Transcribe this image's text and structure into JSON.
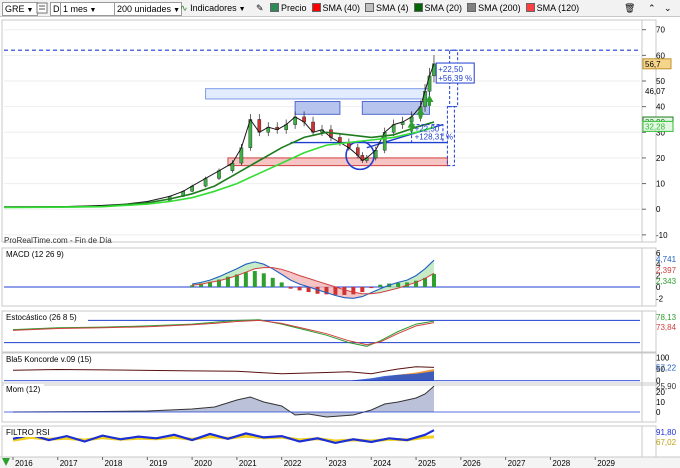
{
  "toolbar": {
    "ticker": "GRE",
    "period_code": "D",
    "timeframe": "1 mes",
    "units": "200 unidades",
    "indicators_label": "Indicadores",
    "legend": [
      {
        "label": "Precio",
        "color": "#2e8b57"
      },
      {
        "label": "SMA (40)",
        "color": "#ff0000"
      },
      {
        "label": "SMA (4)",
        "color": "#c0c0c0"
      },
      {
        "label": "SMA (20)",
        "color": "#006400"
      },
      {
        "label": "SMA (200)",
        "color": "#808080"
      },
      {
        "label": "SMA (120)",
        "color": "#ff4040"
      }
    ]
  },
  "chart_data": [
    {
      "type": "line",
      "panel": "price",
      "source_text": "ProRealTime.com - Fin de Día",
      "x_ticks": [
        "2016",
        "2017",
        "2018",
        "2019",
        "2020",
        "2021",
        "2022",
        "2023",
        "2024",
        "2025",
        "2026",
        "2027",
        "2028",
        "2029"
      ],
      "y_ticks": [
        "70",
        "60",
        "50",
        "40",
        "30",
        "20",
        "10",
        "0",
        "-10"
      ],
      "ylim": [
        -12,
        73
      ],
      "xlim": [
        2015.8,
        2030.0
      ],
      "series": [
        {
          "name": "Precio",
          "color": "#1a1a1a",
          "x": [
            2015.8,
            2016.5,
            2017.0,
            2017.5,
            2018.0,
            2018.5,
            2019.0,
            2019.5,
            2019.8,
            2020.0,
            2020.3,
            2020.6,
            2020.9,
            2021.1,
            2021.3,
            2021.5,
            2021.7,
            2021.9,
            2022.1,
            2022.3,
            2022.5,
            2022.7,
            2022.9,
            2023.1,
            2023.3,
            2023.5,
            2023.7,
            2023.8,
            2023.9,
            2024.1,
            2024.3,
            2024.5,
            2024.7,
            2024.9,
            2025.1,
            2025.2,
            2025.3,
            2025.4
          ],
          "y": [
            1,
            1,
            1,
            1.2,
            1.5,
            2,
            3,
            5,
            7,
            9,
            12,
            15,
            18,
            24,
            35,
            30,
            32,
            31,
            33,
            36,
            34,
            30,
            31,
            28,
            26,
            24,
            21,
            19,
            20,
            23,
            30,
            33,
            34,
            36,
            40,
            46,
            52,
            56.7
          ]
        },
        {
          "name": "SMA (20)",
          "color": "#1e7b1e",
          "x": [
            2015.8,
            2017.0,
            2018.0,
            2019.0,
            2019.5,
            2020.0,
            2020.5,
            2021.0,
            2021.5,
            2022.0,
            2022.5,
            2023.0,
            2023.5,
            2024.0,
            2024.5,
            2025.0,
            2025.4
          ],
          "y": [
            0.8,
            0.9,
            1.1,
            2.5,
            4,
            6,
            9,
            14,
            19,
            24,
            28,
            30,
            29,
            28,
            29,
            32,
            34
          ]
        },
        {
          "name": "SMA (40)",
          "color": "#33dd33",
          "x": [
            2015.8,
            2017.0,
            2018.0,
            2019.0,
            2019.5,
            2020.0,
            2020.5,
            2021.0,
            2021.5,
            2022.0,
            2022.5,
            2023.0,
            2023.5,
            2024.0,
            2024.5,
            2025.0,
            2025.4
          ],
          "y": [
            0.7,
            0.8,
            1,
            2,
            3,
            4.5,
            7,
            10,
            14,
            18,
            22,
            25,
            26,
            27,
            28,
            30,
            32
          ]
        }
      ],
      "annotations": {
        "price_label": "56,7",
        "level_label": "46,07",
        "labels_right": [
          "33,99",
          "32,28"
        ],
        "projection_up": {
          "line1": "+22,50",
          "line2": "+56,39 %"
        },
        "projection_mid": {
          "line1": "+22,50",
          "line2": "+128,31 %"
        },
        "resistance_level": 62
      }
    },
    {
      "type": "bar",
      "panel": "macd",
      "title": "MACD (12 26 9)",
      "y_ticks": [
        "6",
        "4",
        "2",
        "0",
        "-2"
      ],
      "labels_right": [
        "4,741",
        "2,397",
        "2,343"
      ],
      "ylim": [
        -3,
        6.5
      ],
      "x": [
        2020.0,
        2020.2,
        2020.4,
        2020.6,
        2020.8,
        2021.0,
        2021.2,
        2021.4,
        2021.6,
        2021.8,
        2022.0,
        2022.2,
        2022.4,
        2022.6,
        2022.8,
        2023.0,
        2023.2,
        2023.4,
        2023.6,
        2023.8,
        2024.0,
        2024.2,
        2024.4,
        2024.6,
        2024.8,
        2025.0,
        2025.2,
        2025.4
      ],
      "histogram": [
        0.3,
        0.6,
        0.9,
        1.3,
        1.8,
        2.2,
        2.6,
        2.8,
        2.4,
        1.6,
        0.8,
        -0.3,
        -0.6,
        -0.9,
        -1.2,
        -1.3,
        -1.4,
        -1.4,
        -1.3,
        -0.9,
        -0.2,
        0.4,
        0.6,
        0.7,
        0.8,
        1.1,
        1.6,
        2.3
      ],
      "macd_line": [
        0.5,
        0.8,
        1.2,
        1.8,
        2.5,
        3.2,
        4.0,
        4.4,
        4.0,
        3.2,
        2.2,
        1.2,
        0.5,
        0,
        -0.5,
        -1,
        -1.5,
        -1.9,
        -2,
        -1.7,
        -1,
        -0.3,
        0.3,
        0.8,
        1.2,
        2,
        3.2,
        4.7
      ],
      "signal_line": [
        0.3,
        0.5,
        0.8,
        1.1,
        1.5,
        2,
        2.6,
        3.2,
        3.4,
        3.4,
        3.1,
        2.6,
        2,
        1.5,
        1,
        0.5,
        0,
        -0.5,
        -0.9,
        -1.2,
        -1.2,
        -1,
        -0.6,
        -0.2,
        0.3,
        0.8,
        1.5,
        2.4
      ]
    },
    {
      "type": "line",
      "panel": "stochastic",
      "title": "Estocástico (26 8 5)",
      "labels_right": [
        "78,13",
        "73,84"
      ],
      "ylim": [
        0,
        100
      ],
      "x": [
        2016.0,
        2017.0,
        2018.0,
        2019.0,
        2020.0,
        2020.5,
        2021.0,
        2021.5,
        2022.0,
        2022.5,
        2023.0,
        2023.5,
        2023.9,
        2024.2,
        2024.6,
        2025.0,
        2025.4
      ],
      "k": [
        55,
        60,
        62,
        65,
        70,
        75,
        80,
        82,
        70,
        55,
        40,
        20,
        10,
        25,
        50,
        70,
        78
      ],
      "d": [
        53,
        58,
        60,
        63,
        68,
        72,
        77,
        80,
        72,
        58,
        44,
        25,
        14,
        22,
        45,
        65,
        74
      ]
    },
    {
      "type": "area",
      "panel": "koncorde",
      "title": "Bla5 Koncorde v.09 (15)",
      "y_ticks": [
        "100",
        "50",
        "0"
      ],
      "labels_right": [
        "57,22"
      ],
      "ylim": [
        -10,
        110
      ],
      "x": [
        2016.0,
        2017.0,
        2018.0,
        2019.0,
        2020.0,
        2021.0,
        2022.0,
        2023.0,
        2023.5,
        2024.0,
        2024.3,
        2024.6,
        2025.0,
        2025.4
      ],
      "line": [
        45,
        48,
        46,
        44,
        42,
        40,
        30,
        35,
        38,
        30,
        40,
        50,
        60,
        57
      ],
      "blue_area": [
        0,
        0,
        0,
        0,
        0,
        0,
        0,
        0,
        0,
        10,
        20,
        25,
        30,
        40
      ],
      "orange_area": [
        0,
        0,
        0,
        0,
        0,
        0,
        0,
        0,
        0,
        5,
        15,
        25,
        35,
        50
      ]
    },
    {
      "type": "area",
      "panel": "momentum",
      "title": "Mom (12)",
      "y_ticks": [
        "20",
        "10",
        "0"
      ],
      "labels_right": [
        "25,90"
      ],
      "ylim": [
        -8,
        27
      ],
      "x": [
        2016.0,
        2017.0,
        2018.0,
        2019.0,
        2020.0,
        2020.5,
        2021.0,
        2021.3,
        2021.6,
        2022.0,
        2022.3,
        2022.6,
        2023.0,
        2023.3,
        2023.6,
        2024.0,
        2024.3,
        2024.6,
        2025.0,
        2025.2,
        2025.4
      ],
      "values": [
        0,
        0.2,
        0.5,
        1,
        3,
        5,
        12,
        15,
        10,
        6,
        -3,
        -2,
        -5,
        -4,
        -3,
        2,
        8,
        10,
        14,
        18,
        25.9
      ]
    },
    {
      "type": "line",
      "panel": "filtro_rsi",
      "title": "FILTRO RSI",
      "labels_right": [
        "91,80",
        "67,02"
      ],
      "ylim": [
        0,
        100
      ],
      "x": [
        2016.0,
        2016.4,
        2016.8,
        2017.2,
        2017.6,
        2018.0,
        2018.4,
        2018.8,
        2019.2,
        2019.6,
        2020.0,
        2020.4,
        2020.8,
        2021.2,
        2021.6,
        2022.0,
        2022.4,
        2022.8,
        2023.2,
        2023.6,
        2024.0,
        2024.4,
        2024.8,
        2025.2,
        2025.4
      ],
      "blue": [
        60,
        75,
        55,
        70,
        50,
        72,
        58,
        68,
        62,
        75,
        55,
        78,
        60,
        80,
        65,
        70,
        50,
        62,
        45,
        58,
        48,
        62,
        55,
        75,
        91.8
      ],
      "yellow": [
        55,
        65,
        58,
        62,
        55,
        64,
        58,
        62,
        60,
        66,
        58,
        68,
        62,
        70,
        64,
        66,
        56,
        60,
        52,
        56,
        52,
        58,
        56,
        65,
        67.0
      ]
    }
  ]
}
